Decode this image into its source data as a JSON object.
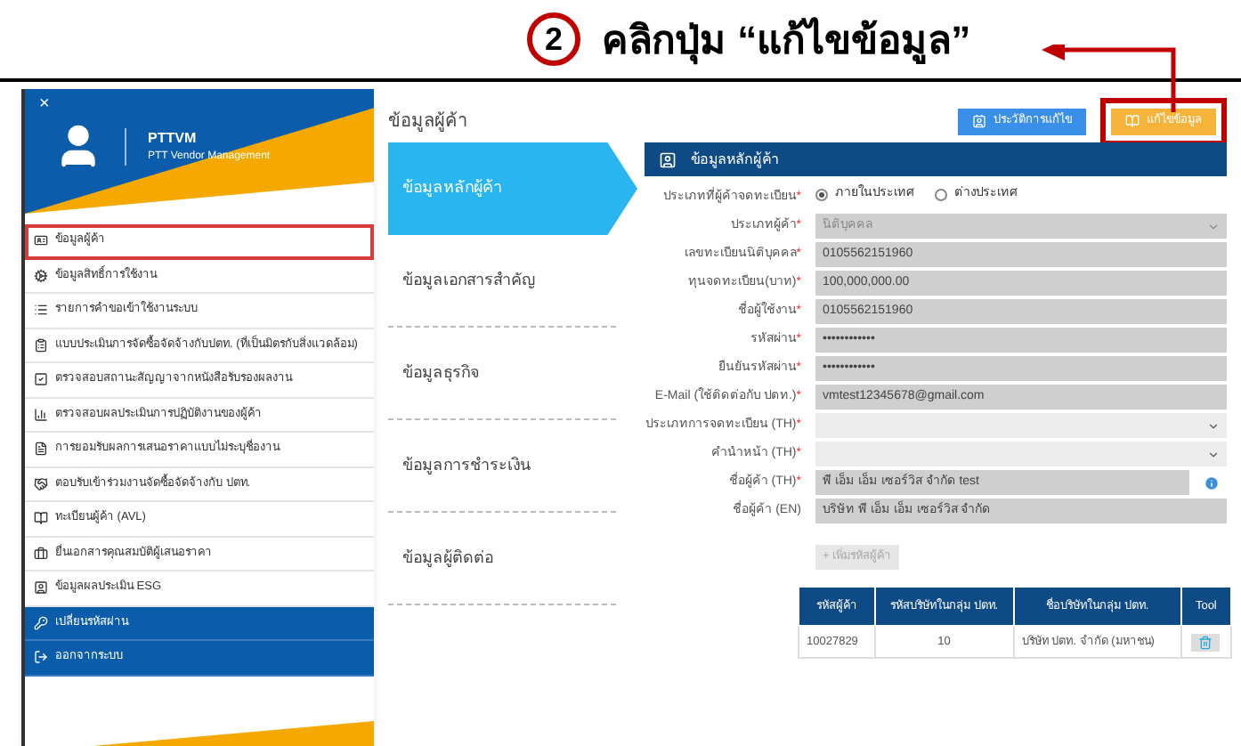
{
  "annotation": {
    "step": "2",
    "text": "คลิกปุ่ม “แก้ไขข้อมูล”"
  },
  "sidebar": {
    "close": "×",
    "app_name": "PTTVM",
    "app_subtitle": "PTT Vendor Management",
    "items": [
      {
        "label": "ข้อมูลผู้ค้า",
        "kind": "menu",
        "selected": true
      },
      {
        "label": "ข้อมูลสิทธิ์การใช้งาน",
        "kind": "menu",
        "selected": false
      },
      {
        "label": "รายการคำขอเข้าใช้งานระบบ",
        "kind": "menu",
        "selected": false
      },
      {
        "label": "แบบประเมินการจัดซื้อจัดจ้างกับปตท. (ที่เป็นมิตรกับสิ่งแวดล้อม)",
        "kind": "menu",
        "selected": false
      },
      {
        "label": "ตรวจสอบสถานะสัญญาจากหนังสือรับรองผลงาน",
        "kind": "menu",
        "selected": false
      },
      {
        "label": "ตรวจสอบผลประเมินการปฏิบัติงานของผู้ค้า",
        "kind": "menu",
        "selected": false
      },
      {
        "label": "การยอมรับผลการเสนอราคาแบบไม่ระบุชื่องาน",
        "kind": "menu",
        "selected": false
      },
      {
        "label": "ตอบรับเข้าร่วมงานจัดซื้อจัดจ้างกับ ปตท.",
        "kind": "menu",
        "selected": false
      },
      {
        "label": "ทะเบียนผู้ค้า (AVL)",
        "kind": "menu",
        "selected": false
      },
      {
        "label": "ยื่นเอกสารคุณสมบัติผู้เสนอราคา",
        "kind": "menu",
        "selected": false
      },
      {
        "label": "ข้อมูลผลประเมิน ESG",
        "kind": "menu",
        "selected": false
      },
      {
        "label": "เปลี่ยนรหัสผ่าน",
        "kind": "action",
        "selected": false
      },
      {
        "label": "ออกจากระบบ",
        "kind": "action",
        "selected": false
      }
    ]
  },
  "page": {
    "title": "ข้อมูลผู้ค้า",
    "buttons": [
      {
        "label": "ประวัติการแก้ไข",
        "kind": "history",
        "highlighted": false
      },
      {
        "label": "แก้ไขข้อมูล",
        "kind": "edit",
        "highlighted": true
      }
    ]
  },
  "steps": [
    {
      "label": "ข้อมูลหลักผู้ค้า",
      "selected": true
    },
    {
      "label": "ข้อมูลเอกสารสำคัญ",
      "selected": false
    },
    {
      "label": "ข้อมูลธุรกิจ",
      "selected": false
    },
    {
      "label": "ข้อมูลการชำระเงิน",
      "selected": false
    },
    {
      "label": "ข้อมูลผู้ติดต่อ",
      "selected": false
    }
  ],
  "panel_title": "ข้อมูลหลักผู้ค้า",
  "fields": [
    {
      "kind": "radio",
      "label": "ประเภทที่ผู้ค้าจดทะเบียน",
      "required_mark": "*",
      "options": [
        {
          "label": "ภายในประเทศ",
          "selected": true
        },
        {
          "label": "ต่างประเทศ",
          "selected": false
        }
      ]
    },
    {
      "kind": "select",
      "label": "ประเภทผู้ค้า",
      "required_mark": "*",
      "value": "นิติบุคคล",
      "disabled": true
    },
    {
      "kind": "text",
      "label": "เลขทะเบียนนิติบุคคล",
      "required_mark": "*",
      "value": "0105562151960"
    },
    {
      "kind": "text",
      "label": "ทุนจดทะเบียน(บาท)",
      "required_mark": "*",
      "value": "100,000,000.00"
    },
    {
      "kind": "text",
      "label": "ชื่อผู้ใช้งาน",
      "required_mark": "*",
      "value": "0105562151960"
    },
    {
      "kind": "text",
      "label": "รหัสผ่าน",
      "required_mark": "*",
      "value": "••••••••••••"
    },
    {
      "kind": "text",
      "label": "ยืนยันรหัสผ่าน",
      "required_mark": "*",
      "value": "••••••••••••"
    },
    {
      "kind": "text",
      "label": "E-Mail (ใช้ติดต่อกับ ปตท.)",
      "required_mark": "*",
      "value": "vmtest12345678@gmail.com"
    },
    {
      "kind": "select",
      "label": "ประเภทการจดทะเบียน (TH)",
      "required_mark": "*",
      "disabled": false
    },
    {
      "kind": "select",
      "label": "คำนำหน้า (TH)",
      "required_mark": "*",
      "disabled": false
    },
    {
      "kind": "text",
      "label": "ชื่อผู้ค้า (TH)",
      "required_mark": "*",
      "value": "พี เอ็ม เอ็ม เซอร์วิส จำกัด test",
      "info": true
    },
    {
      "kind": "text",
      "label": "ชื่อผู้ค้า (EN)",
      "value": "บริษัท พี เอ็ม เอ็ม เซอร์วิส จำกัด"
    }
  ],
  "add_button": "+ เพิ่มรหัสผู้ค้า",
  "table": {
    "columns": [
      "รหัสผู้ค้า",
      "รหัสบริษัทในกลุ่ม ปตท.",
      "ชื่อบริษัทในกลุ่ม ปตท.",
      "Tool"
    ],
    "rows": [
      [
        "10027829",
        "10",
        "บริษัท ปตท. จำกัด (มหาชน)"
      ]
    ]
  }
}
